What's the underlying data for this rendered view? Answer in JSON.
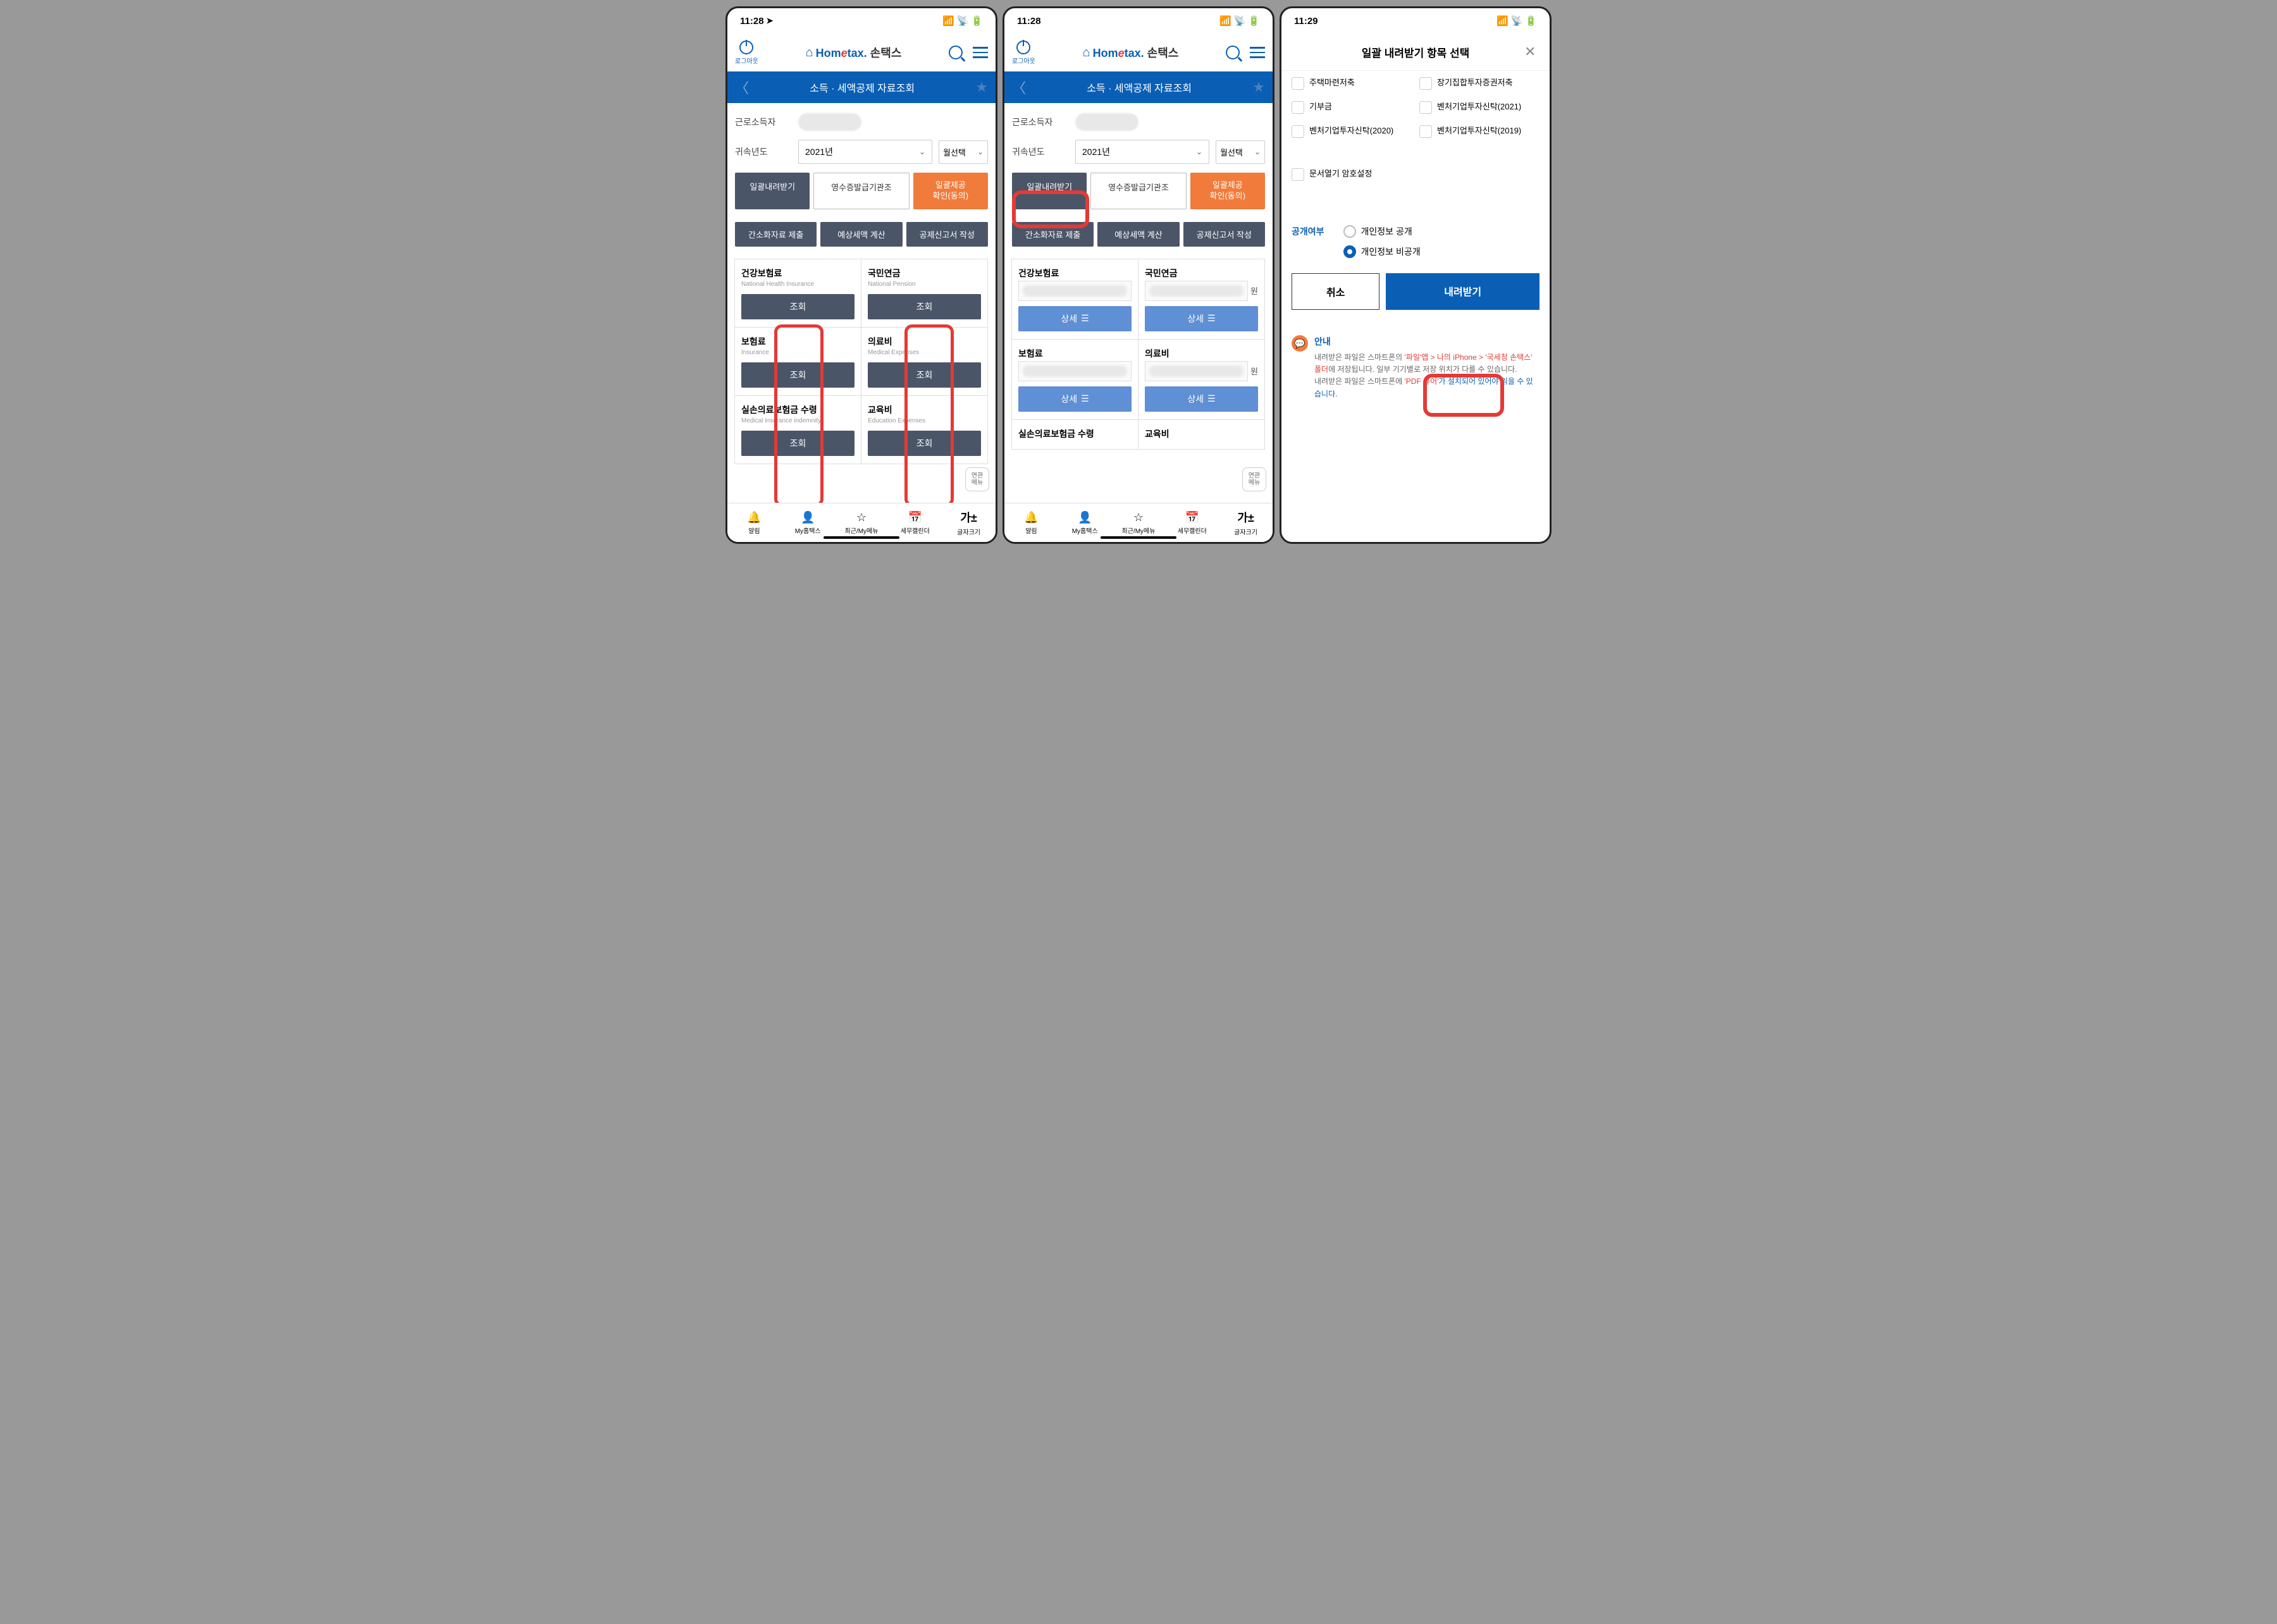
{
  "status_time_1": "11:28",
  "status_time_2": "11:28",
  "status_time_3": "11:29",
  "logout_label": "로그아웃",
  "logo_hometax": "Hom",
  "logo_e": "e",
  "logo_tax": "tax.",
  "logo_sontax": "손택스",
  "page_title": "소득 · 세액공제 자료조회",
  "form": {
    "income_label": "근로소득자",
    "year_label": "귀속년도",
    "year_value": "2021년",
    "month_value": "월선택"
  },
  "buttons": {
    "batch_download": "일괄내려받기",
    "receipt_issuer": "영수증발급기관조",
    "batch_provide_line1": "일괄제공",
    "batch_provide_line2": "확인(동의)",
    "simplify_submit": "간소화자료 제출",
    "estimate_tax": "예상세액 계산",
    "deduction_report": "공제신고서 작성",
    "query": "조회",
    "detail": "상세",
    "cancel": "취소",
    "download": "내려받기"
  },
  "cards": [
    {
      "title": "건강보험료",
      "sub": "National Health Insurance"
    },
    {
      "title": "국민연금",
      "sub": "National Pension"
    },
    {
      "title": "보험료",
      "sub": "Insurance"
    },
    {
      "title": "의료비",
      "sub": "Medical Expenses"
    },
    {
      "title": "실손의료보험금 수령",
      "sub": "Medical insurance indemnity"
    },
    {
      "title": "교육비",
      "sub": "Education Expenses"
    }
  ],
  "cards2": [
    {
      "title": "건강보험료"
    },
    {
      "title": "국민연금"
    },
    {
      "title": "보험료"
    },
    {
      "title": "의료비"
    },
    {
      "title": "실손의료보험금 수령"
    },
    {
      "title": "교육비"
    }
  ],
  "unit_won": "원",
  "floating": "연관\n메뉴",
  "bottom_nav": [
    {
      "icon": "🔔",
      "label": "알림"
    },
    {
      "icon": "👤",
      "label": "My홈택스"
    },
    {
      "icon": "☆",
      "label": "최근/My메뉴"
    },
    {
      "icon": "📅",
      "label": "세무캘린더"
    },
    {
      "icon": "가±",
      "label": "글자크기"
    }
  ],
  "modal": {
    "title": "일괄 내려받기 항목 선택",
    "items": [
      [
        "주택마련저축",
        "장기집합투자증권저축"
      ],
      [
        "기부금",
        "벤처기업투자신탁(2021)"
      ],
      [
        "벤처기업투자신탁(2020)",
        "벤처기업투자신탁(2019)"
      ]
    ],
    "doc_encrypt": "문서열기 암호설정",
    "disclosure_label": "공개여부",
    "radio_public": "개인정보 공개",
    "radio_private": "개인정보 비공개",
    "notice_title": "안내",
    "notice_t1": "내려받은 파일은 스마트폰의 ",
    "notice_h1": "'파일'앱 > 나의 iPhone > '국세청 손택스' 폴더",
    "notice_t2": "에 저장됩니다. 일부 기기별로 저장 위치가 다를 수 있습니다.",
    "notice_t3": "내려받은 파일은 스마트폰에 ",
    "notice_h2": "'PDF 뷰어'",
    "notice_t4": "가 설치되어 있어야 읽을 수 있습니다."
  }
}
